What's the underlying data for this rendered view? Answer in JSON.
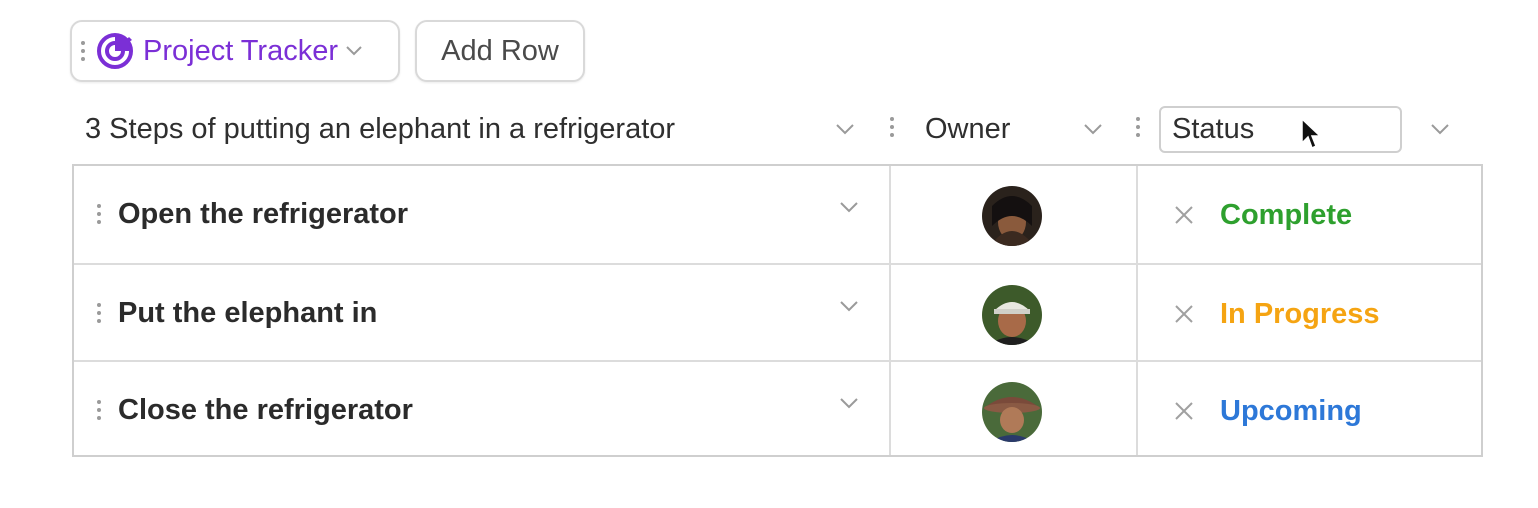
{
  "toolbar": {
    "tracker_label": "Project Tracker",
    "add_row_label": "Add Row",
    "accent": "#7b2fd6"
  },
  "columns": {
    "title": "3 Steps of putting an elephant in a refrigerator",
    "owner": "Owner",
    "status": "Status"
  },
  "rows": [
    {
      "step": "Open the refrigerator",
      "status": "Complete",
      "status_color": "#2ea02e",
      "owner_icon": "avatar"
    },
    {
      "step": "Put the elephant in",
      "status": "In Progress",
      "status_color": "#f5a412",
      "owner_icon": "avatar"
    },
    {
      "step": "Close the refrigerator",
      "status": "Upcoming",
      "status_color": "#2d78d8",
      "owner_icon": "avatar"
    }
  ]
}
